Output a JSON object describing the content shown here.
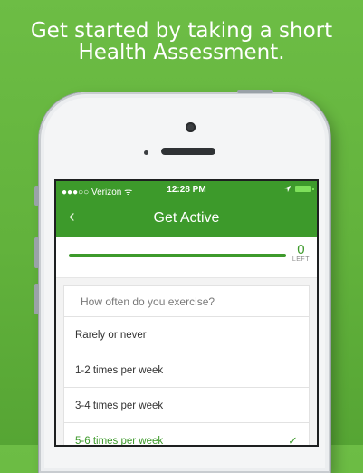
{
  "headline": {
    "line1": "Get started by taking a short",
    "line2": "Health Assessment."
  },
  "status_bar": {
    "carrier": "●●●○○ Verizon ᯤ",
    "time": "12:28 PM",
    "location_icon": "location-arrow-icon",
    "battery_icon": "battery-charging-icon"
  },
  "nav": {
    "back_label": "‹",
    "title": "Get Active"
  },
  "progress": {
    "fraction_complete": 1.0,
    "remaining_count": "0",
    "remaining_label": "LEFT"
  },
  "question": {
    "text": "How often do you exercise?",
    "options": [
      {
        "label": "Rarely or never",
        "selected": false
      },
      {
        "label": "1-2 times per week",
        "selected": false
      },
      {
        "label": "3-4 times per week",
        "selected": false
      },
      {
        "label": "5-6 times per week",
        "selected": true
      }
    ],
    "check_glyph": "✓"
  },
  "colors": {
    "background_green": "#62b23c",
    "app_green": "#3d9a2b"
  }
}
